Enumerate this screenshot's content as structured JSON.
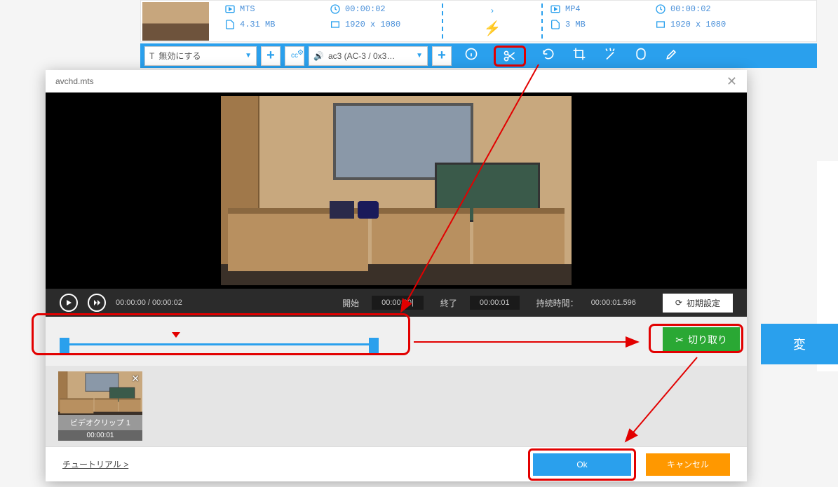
{
  "source": {
    "format": "MTS",
    "duration": "00:00:02",
    "size": "4.31 MB",
    "resolution": "1920 x 1080"
  },
  "target": {
    "format": "MP4",
    "duration": "00:00:02",
    "size": "3 MB",
    "resolution": "1920 x 1080"
  },
  "toolbar": {
    "text_option": "無効にする",
    "audio_option": "ac3 (AC-3 / 0x3…"
  },
  "modal": {
    "title": "avchd.mts",
    "playback": {
      "current": "00:00:00",
      "total": "00:00:02",
      "start_label": "開始",
      "start_value": "00:00:00|",
      "end_label": "終了",
      "end_value": "00:00:01",
      "duration_label": "持続時間：",
      "duration_value": "00:00:01.596",
      "reset_label": "初期設定"
    },
    "cut_label": "切り取り",
    "clip": {
      "name": "ビデオクリップ 1",
      "time": "00:00:01"
    },
    "footer": {
      "tutorial": "チュートリアル >",
      "ok": "Ok",
      "cancel": "キャンセル"
    }
  },
  "bg_button": "変"
}
